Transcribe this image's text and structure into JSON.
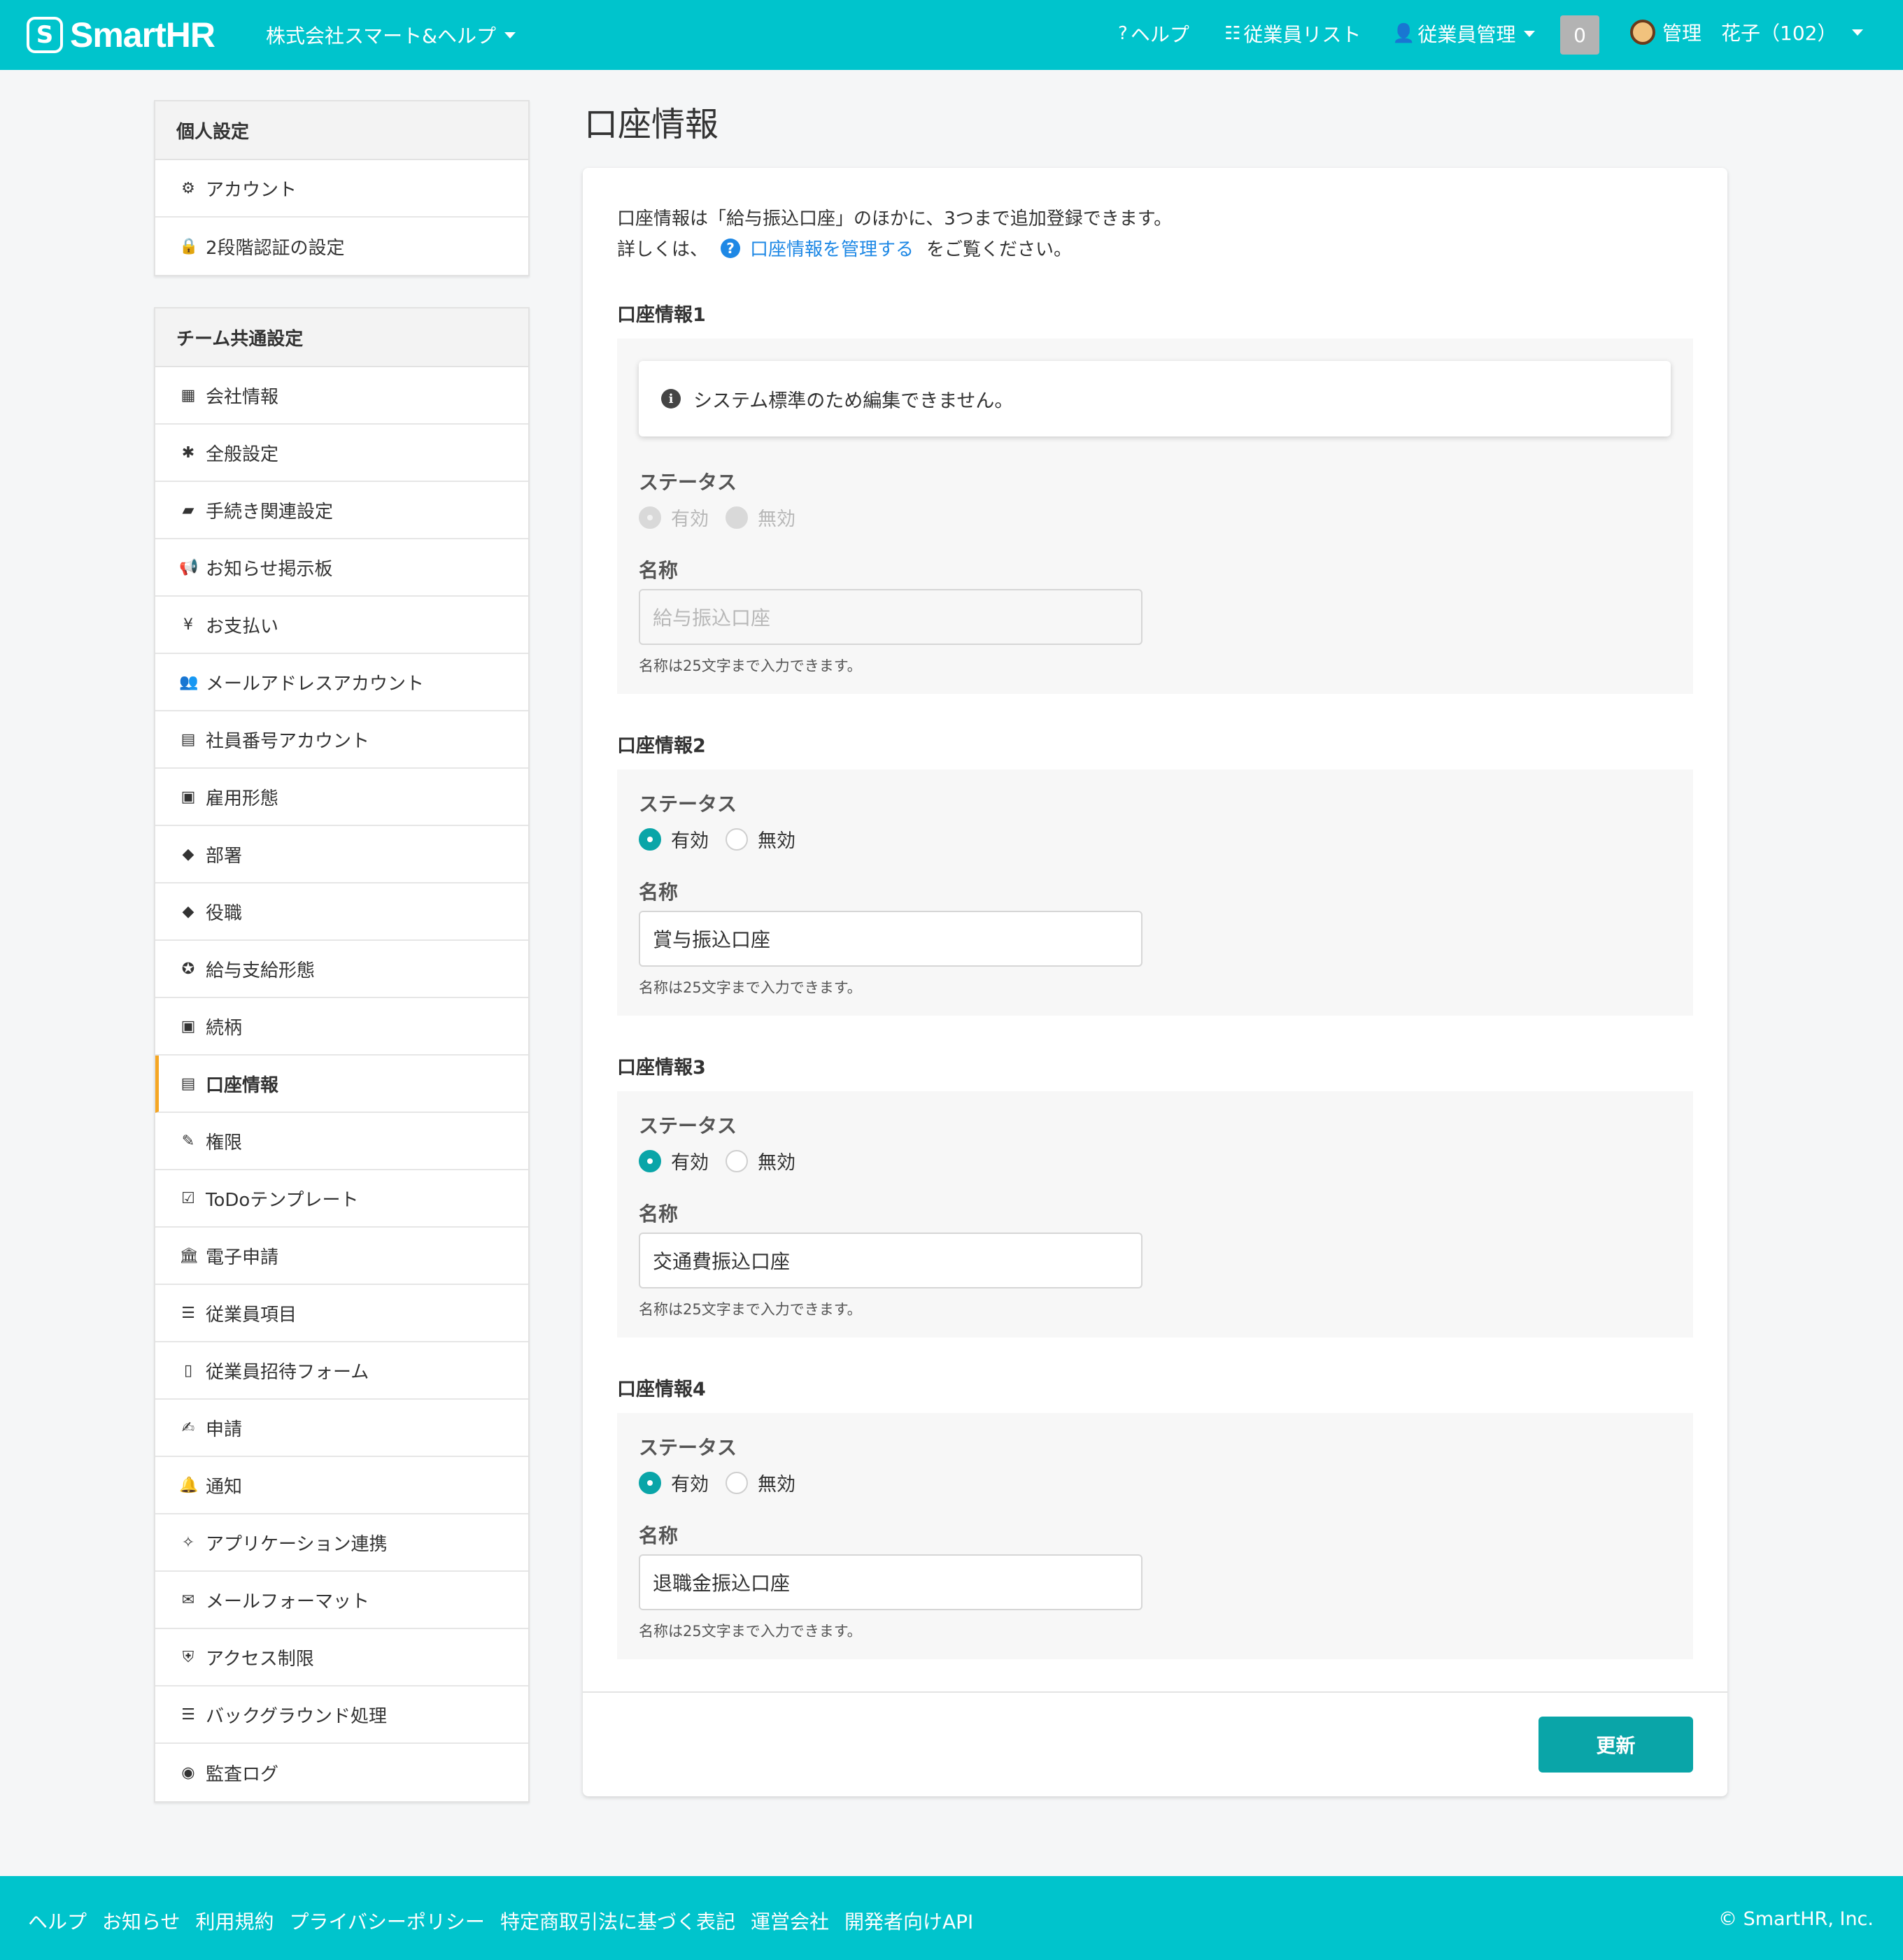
{
  "header": {
    "logo_mark": "S",
    "logo_text": "SmartHR",
    "company": "株式会社スマート&ヘルプ",
    "nav_help": "ヘルプ",
    "nav_help_icon": "?",
    "nav_employee_list": "従業員リスト",
    "nav_employee_list_icon": "☷",
    "nav_employee_mgmt": "従業員管理",
    "nav_employee_mgmt_icon": "👤",
    "notification_count": "0",
    "user_name": "管理　花子（102）"
  },
  "sidebar": {
    "personal": {
      "heading": "個人設定",
      "items": [
        {
          "icon": "⚙",
          "label": "アカウント"
        },
        {
          "icon": "🔒",
          "label": "2段階認証の設定"
        }
      ]
    },
    "team": {
      "heading": "チーム共通設定",
      "items": [
        {
          "icon": "▦",
          "label": "会社情報"
        },
        {
          "icon": "✱",
          "label": "全般設定"
        },
        {
          "icon": "▰",
          "label": "手続き関連設定"
        },
        {
          "icon": "📢",
          "label": "お知らせ掲示板"
        },
        {
          "icon": "¥",
          "label": "お支払い"
        },
        {
          "icon": "👥",
          "label": "メールアドレスアカウント"
        },
        {
          "icon": "▤",
          "label": "社員番号アカウント"
        },
        {
          "icon": "▣",
          "label": "雇用形態"
        },
        {
          "icon": "◆",
          "label": "部署"
        },
        {
          "icon": "◆",
          "label": "役職"
        },
        {
          "icon": "✪",
          "label": "給与支給形態"
        },
        {
          "icon": "▣",
          "label": "続柄"
        },
        {
          "icon": "▤",
          "label": "口座情報"
        },
        {
          "icon": "✎",
          "label": "権限"
        },
        {
          "icon": "☑",
          "label": "ToDoテンプレート"
        },
        {
          "icon": "🏛",
          "label": "電子申請"
        },
        {
          "icon": "☰",
          "label": "従業員項目"
        },
        {
          "icon": "▯",
          "label": "従業員招待フォーム"
        },
        {
          "icon": "✍",
          "label": "申請"
        },
        {
          "icon": "🔔",
          "label": "通知"
        },
        {
          "icon": "✧",
          "label": "アプリケーション連携"
        },
        {
          "icon": "✉",
          "label": "メールフォーマット"
        },
        {
          "icon": "⛨",
          "label": "アクセス制限"
        },
        {
          "icon": "☰",
          "label": "バックグラウンド処理"
        },
        {
          "icon": "◉",
          "label": "監査ログ"
        }
      ],
      "active_label": "口座情報"
    }
  },
  "main": {
    "title": "口座情報",
    "intro_line1": "口座情報は「給与振込口座」のほかに、3つまで追加登録できます。",
    "intro_prefix": "詳しくは、",
    "intro_link_icon": "?",
    "intro_link": "口座情報を管理する",
    "intro_suffix": "をご覧ください。",
    "notice_icon": "i",
    "notice": "システム標準のため編集できません。",
    "status_label": "ステータス",
    "name_label": "名称",
    "option_active": "有効",
    "option_inactive": "無効",
    "hint": "名称は25文字まで入力できます。",
    "accounts": [
      {
        "title": "口座情報1",
        "name": "給与振込口座",
        "status": "有効",
        "editable": false
      },
      {
        "title": "口座情報2",
        "name": "賞与振込口座",
        "status": "有効",
        "editable": true
      },
      {
        "title": "口座情報3",
        "name": "交通費振込口座",
        "status": "有効",
        "editable": true
      },
      {
        "title": "口座情報4",
        "name": "退職金振込口座",
        "status": "有効",
        "editable": true
      }
    ],
    "update_button": "更新"
  },
  "footer": {
    "links": [
      "ヘルプ",
      "お知らせ",
      "利用規約",
      "プライバシーポリシー",
      "特定商取引法に基づく表記",
      "運営会社",
      "開発者向けAPI"
    ],
    "copyright": "© SmartHR, Inc."
  },
  "colors": {
    "brand": "#00c4cc",
    "accent": "#0aa5a8",
    "link": "#1e88e5",
    "active_marker": "#f5a623"
  }
}
